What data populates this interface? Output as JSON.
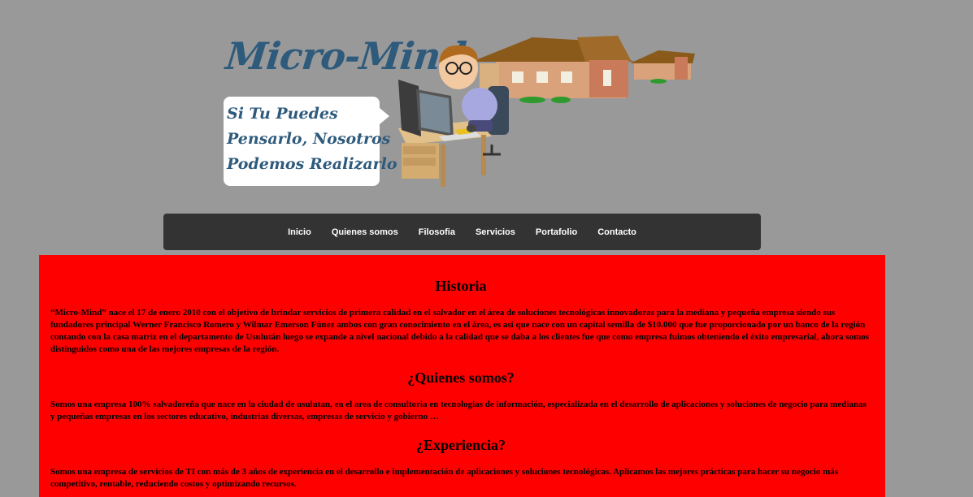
{
  "header": {
    "logo_text": "Micro-Mind",
    "slogan_lines": [
      "Si Tu Puedes",
      "Pensarlo, Nosotros",
      "Podemos Realizarlo"
    ]
  },
  "nav": {
    "items": [
      "Inicio",
      "Quienes somos",
      "Filosofia",
      "Servicios",
      "Portafolio",
      "Contacto"
    ]
  },
  "main": {
    "sections": [
      {
        "title": "Historia",
        "text": "“Micro-Mind” nace el 17 de enero 2010 con el objetivo de brindar servicios de primera calidad en el salvador en el área de soluciones tecnológicas innovadoras para la mediana y pequeña empresa siendo sus fundadores principal Werner Francisco Romero y Wilmar Emerson Fúnez ambos con gran conocimiento en el área, es así que nace con un capital semilla de $10.000 que fue proporcionado por un banco de la región contando con la casa matriz en el departamento de Usulután luego se expande a nivel nacional debido a la calidad que se daba a los clientes fue que como empresa fuimos obteniendo el éxito empresarial, ahora somos distinguidos como una de las mejores empresas de la región."
      },
      {
        "title": "¿Quienes somos?",
        "text": "Somos una empresa 100% salvadoreña que nace en la ciudad de usulutan, en el area de consultoria en tecnologias de información, especializada en el desarrollo de aplicaciones y soluciones de negocio para medianas y pequeñas empresas en los sectores educativo, industrias diversas, empresas de servicio y gobierno …"
      },
      {
        "title": "¿Experiencia?",
        "text": "Somos una empresa de servicios de TI con más de 3 años de experiencia en el desarrollo e implementación de aplicaciones y soluciones tecnológicas. Aplicamos las mejores prácticas para hacer su negocio más competitivo, rentable, reduciendo costos y optimizando recursos."
      }
    ]
  },
  "colors": {
    "page_bg": "#999999",
    "nav_bg": "#333333",
    "content_bg": "#ff0000",
    "logo_color": "#2e5a7c"
  }
}
